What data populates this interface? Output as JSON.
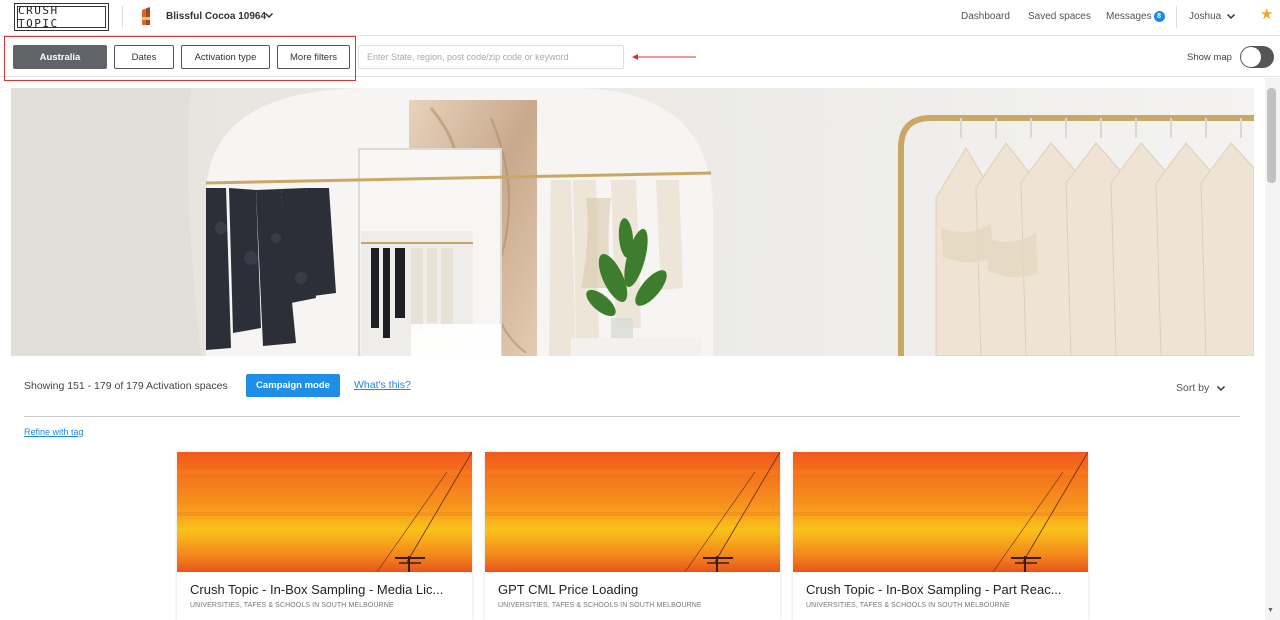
{
  "header": {
    "logo_text": "CRUSH TOPIC",
    "brand_name": "Blissful Cocoa 10964",
    "nav": {
      "dashboard": "Dashboard",
      "saved_spaces": "Saved spaces",
      "messages": "Messages",
      "messages_count": "8",
      "user": "Joshua"
    }
  },
  "filters": {
    "location": "Australia",
    "dates": "Dates",
    "activation_type": "Activation type",
    "more_filters": "More filters",
    "search_placeholder": "Enter State, region, post code/zip code or keyword",
    "show_map": "Show map"
  },
  "results": {
    "count_text": "Showing 151 - 179 of 179 Activation spaces",
    "campaign_mode": "Campaign mode",
    "whats_this": "What's this?",
    "sort_by": "Sort by",
    "refine_tag": "Refine with tag"
  },
  "cards": [
    {
      "title": "Crush Topic - In-Box Sampling - Media Lic...",
      "subtitle": "UNIVERSITIES, TAFES & SCHOOLS in SOUTH MELBOURNE"
    },
    {
      "title": "GPT CML Price Loading",
      "subtitle": "UNIVERSITIES, TAFES & SCHOOLS in SOUTH MELBOURNE"
    },
    {
      "title": "Crush Topic - In-Box Sampling - Part Reac...",
      "subtitle": "UNIVERSITIES, TAFES & SCHOOLS in SOUTH MELBOURNE"
    }
  ],
  "colors": {
    "accent": "#1e8fe8",
    "highlight": "#d9322e",
    "active_filter": "#606368",
    "star": "#f5a623"
  },
  "icons": [
    "brand-icon",
    "chevron-down-icon",
    "star-icon",
    "arrow-left-icon"
  ]
}
